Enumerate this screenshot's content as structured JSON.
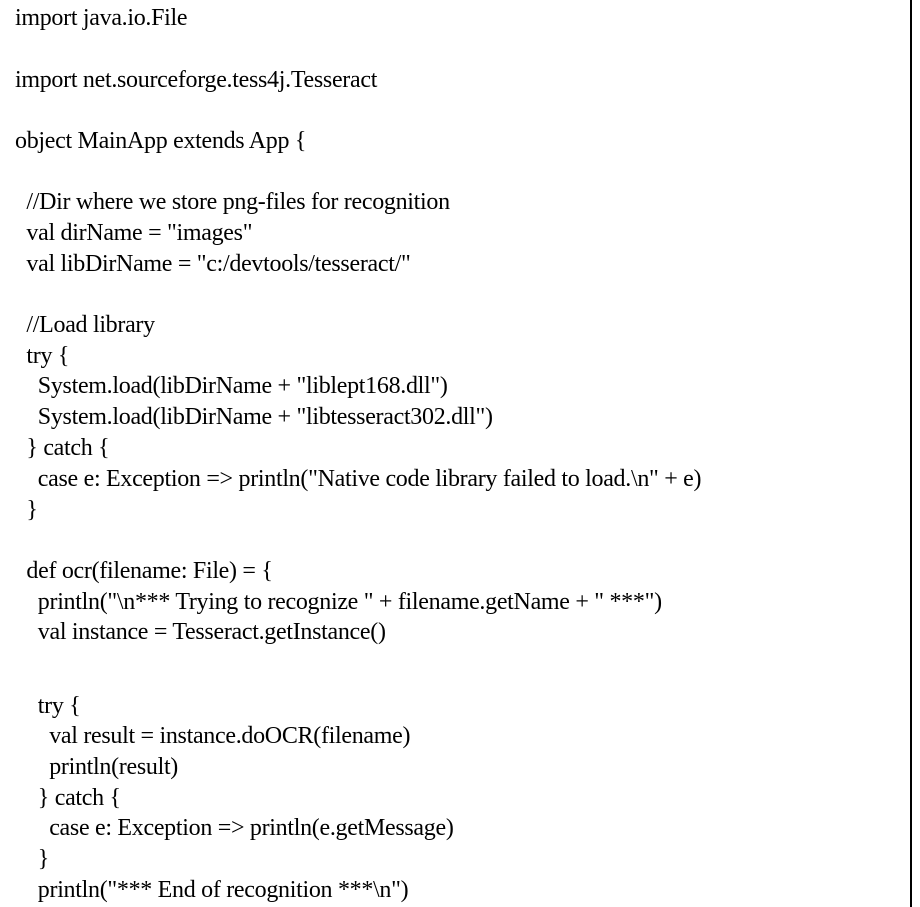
{
  "document": {
    "lines": [
      "import java.io.File",
      "",
      "import net.sourceforge.tess4j.Tesseract",
      "",
      "object MainApp extends App {",
      "",
      "  //Dir where we store png-files for recognition",
      "  val dirName = \"images\"",
      "  val libDirName = \"c:/devtools/tesseract/\"",
      "",
      "  //Load library",
      "  try {",
      "    System.load(libDirName + \"liblept168.dll\")",
      "    System.load(libDirName + \"libtesseract302.dll\")",
      "  } catch {",
      "    case e: Exception => println(\"Native code library failed to load.\\n\" + e)",
      "  }",
      "",
      "  def ocr(filename: File) = {",
      "    println(\"\\n*** Trying to recognize \" + filename.getName + \" ***\")",
      "    val instance = Tesseract.getInstance()",
      "",
      "",
      "    try {",
      "      val result = instance.doOCR(filename)",
      "      println(result)",
      "    } catch {",
      "      case e: Exception => println(e.getMessage)",
      "    }",
      "    println(\"*** End of recognition ***\\n\")"
    ]
  }
}
